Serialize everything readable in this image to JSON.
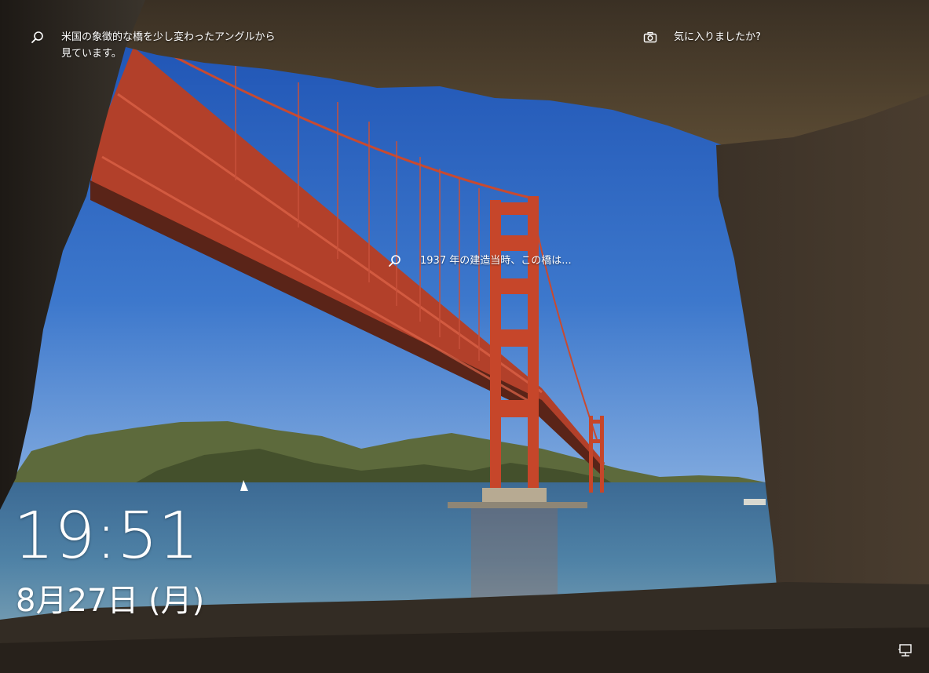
{
  "lock_screen": {
    "info_text": "米国の象徴的な橋を少し変わったアングルから\n見ています。",
    "like_text": "気に入りましたか?",
    "bridge_hotspot_text": "1937 年の建造当時、この橋は...",
    "time": "19:51",
    "date": "8月27日 (月)"
  },
  "icons": {
    "info": "search-icon",
    "like": "camera-icon",
    "bridge": "search-icon",
    "network": "network-icon"
  },
  "colors": {
    "sky_top": "#1e56b8",
    "sky_bottom": "#6a9ad8",
    "bridge": "#c6462a",
    "water": "#3f6f98",
    "rock": "#2c251f"
  }
}
